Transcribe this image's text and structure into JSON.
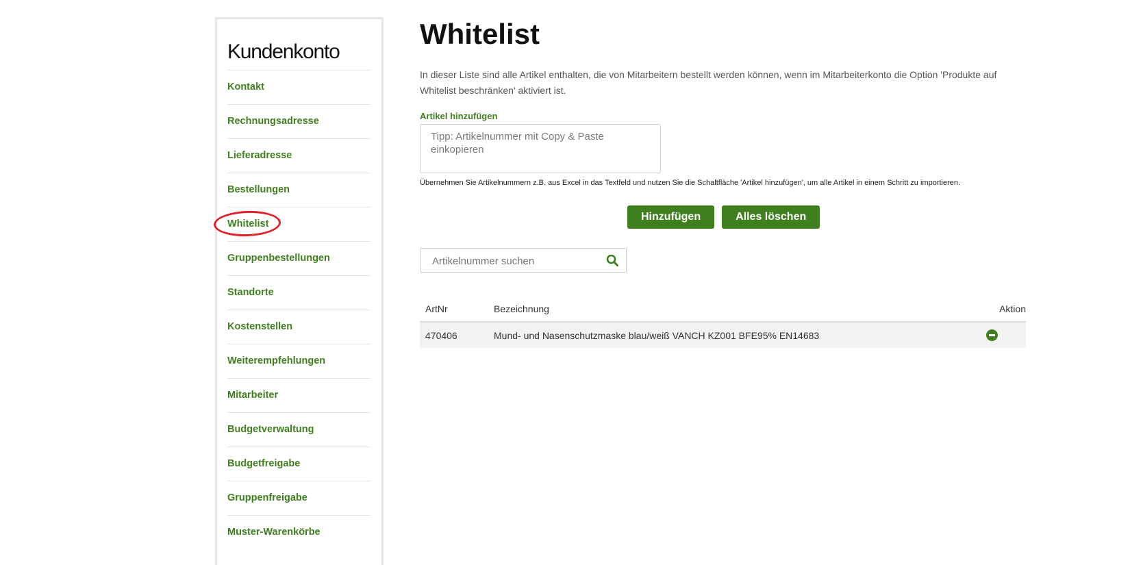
{
  "sidebar": {
    "title": "Kundenkonto",
    "items": [
      {
        "label": "Kontakt"
      },
      {
        "label": "Rechnungsadresse"
      },
      {
        "label": "Lieferadresse"
      },
      {
        "label": "Bestellungen"
      },
      {
        "label": "Whitelist",
        "active": true
      },
      {
        "label": "Gruppenbestellungen"
      },
      {
        "label": "Standorte"
      },
      {
        "label": "Kostenstellen"
      },
      {
        "label": "Weiterempfehlungen"
      },
      {
        "label": "Mitarbeiter"
      },
      {
        "label": "Budgetverwaltung"
      },
      {
        "label": "Budgetfreigabe"
      },
      {
        "label": "Gruppenfreigabe"
      },
      {
        "label": "Muster-Warenkörbe"
      }
    ]
  },
  "main": {
    "title": "Whitelist",
    "intro": "In dieser Liste sind alle Artikel enthalten, die von Mitarbeitern bestellt werden können, wenn im Mitarbeiterkonto die Option 'Produkte auf Whitelist beschränken' aktiviert ist.",
    "add_label": "Artikel hinzufügen",
    "add_placeholder": "Tipp: Artikelnummer mit Copy & Paste einkopieren",
    "add_value": "",
    "hint": "Übernehmen Sie Artikelnummern z.B. aus Excel in das Textfeld und nutzen Sie die Schaltfläche 'Artikel hinzufügen', um alle Artikel in einem Schritt zu importieren.",
    "add_button": "Hinzufügen",
    "clear_button": "Alles löschen",
    "search_placeholder": "Artikelnummer suchen",
    "search_value": "",
    "search_icon": "search-icon",
    "table": {
      "headers": {
        "artnr": "ArtNr",
        "name": "Bezeichnung",
        "action": "Aktion"
      },
      "rows": [
        {
          "artnr": "470406",
          "name": "Mund- und Nasenschutzmaske blau/weiß VANCH KZ001 BFE95% EN14683",
          "action_icon": "remove-icon"
        }
      ]
    }
  },
  "colors": {
    "accent": "#3f7f1f",
    "highlight_circle": "#e0202a"
  }
}
